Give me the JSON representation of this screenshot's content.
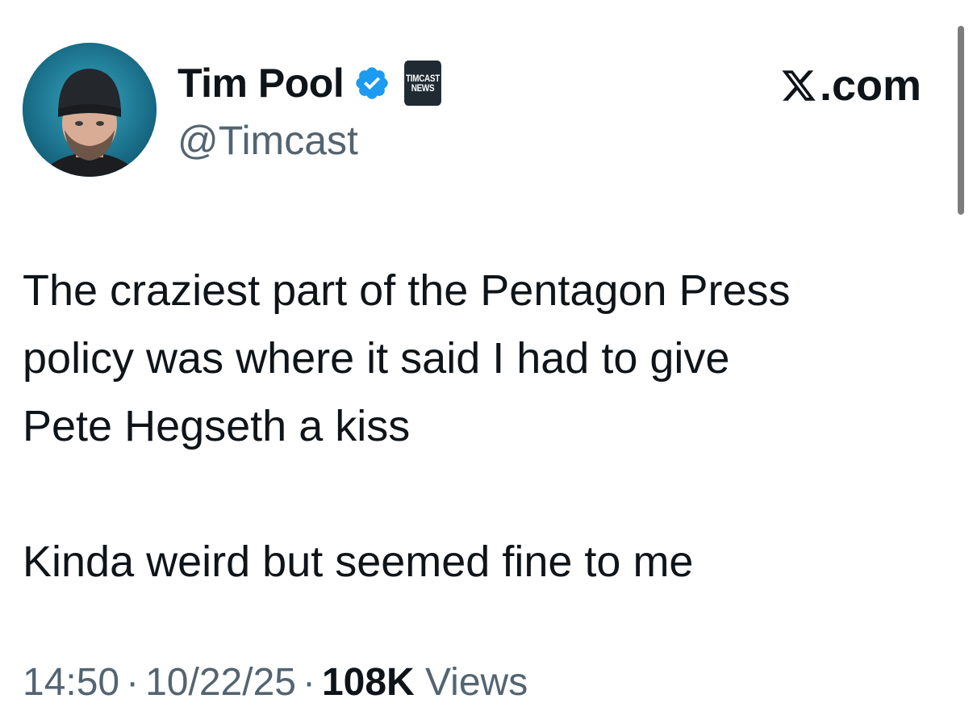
{
  "author": {
    "display_name": "Tim Pool",
    "handle": "@Timcast",
    "verified_icon": "verified-badge-icon",
    "affiliate_badge": {
      "line1": "TIMCAST",
      "line2": "NEWS"
    }
  },
  "source": {
    "label": ".com",
    "icon": "x-logo-icon"
  },
  "tweet": {
    "lines_para1": [
      "The craziest part of the Pentagon Press",
      "policy was where it said I had to give",
      "Pete Hegseth a kiss"
    ],
    "para2": "Kinda weird but seemed fine to me"
  },
  "meta": {
    "time": "14:50",
    "date": "10/22/25",
    "separator": "·",
    "views_count": "108K",
    "views_label": "Views"
  },
  "colors": {
    "text_primary": "#0f1419",
    "text_secondary": "#536471",
    "verified_blue": "#1d9bf0"
  }
}
